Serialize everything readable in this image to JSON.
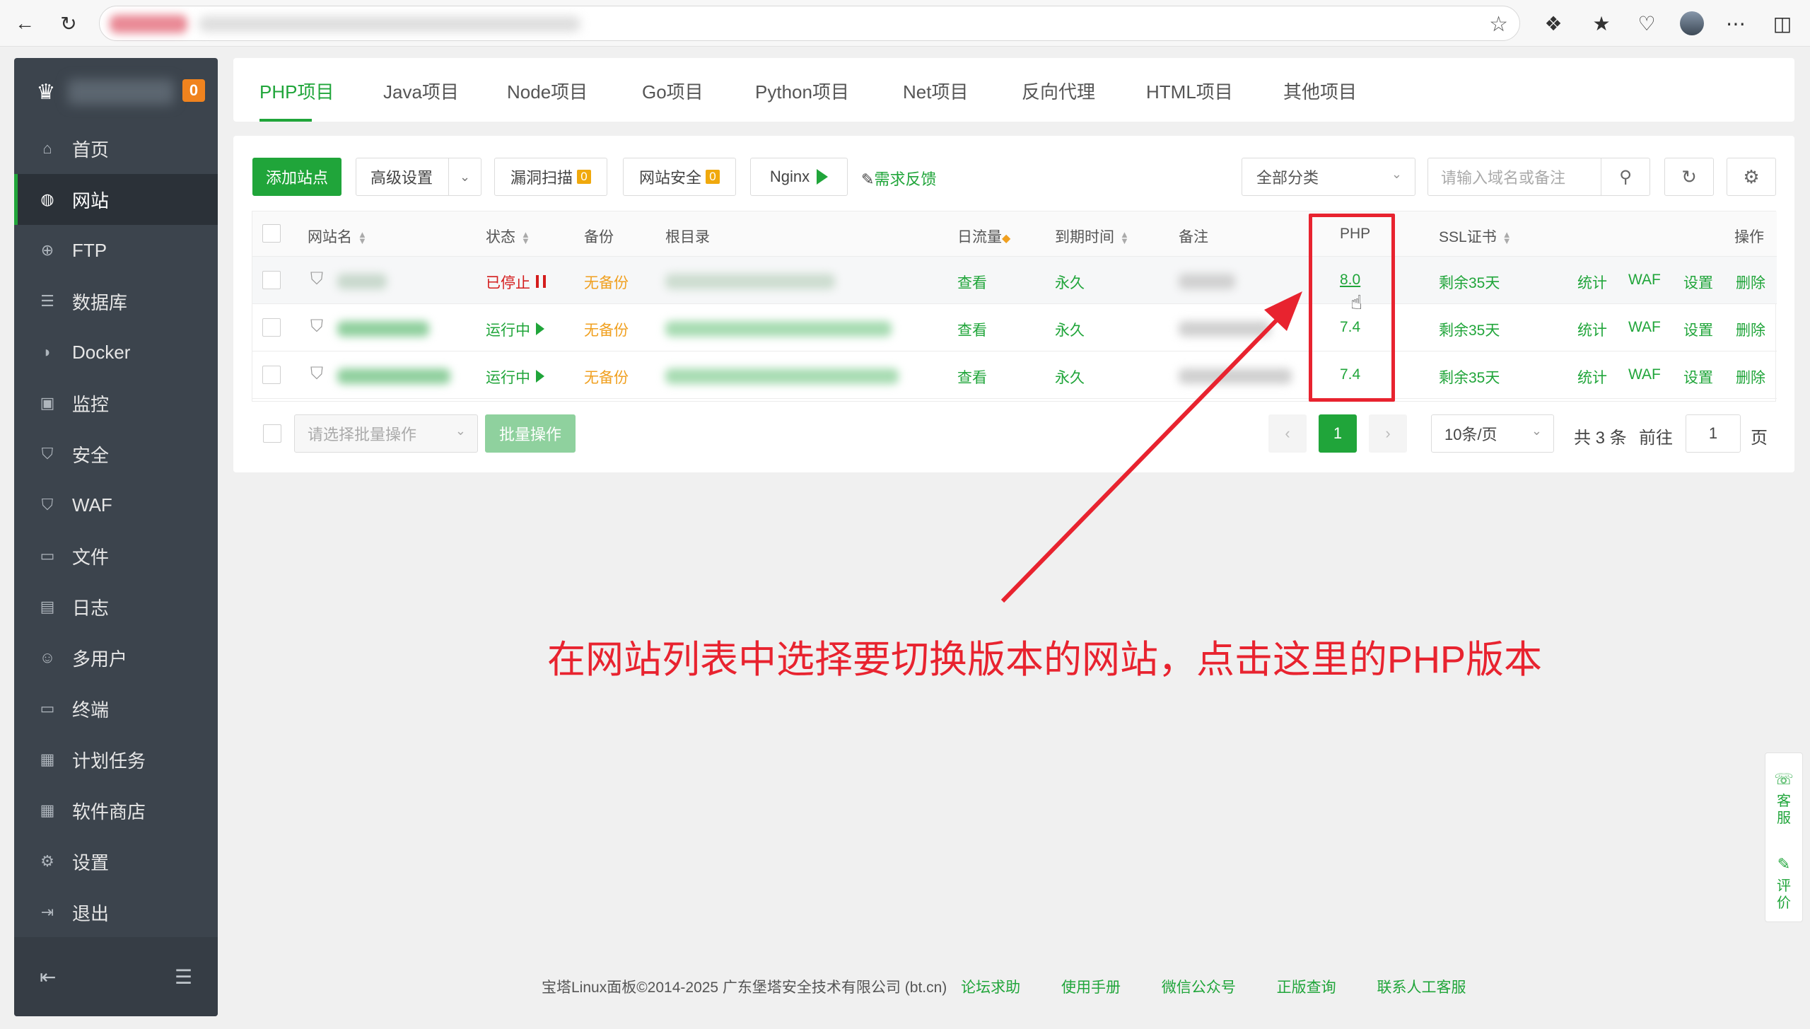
{
  "tabs": [
    "PHP项目",
    "Java项目",
    "Node项目",
    "Go项目",
    "Python项目",
    "Net项目",
    "反向代理",
    "HTML项目",
    "其他项目"
  ],
  "sidebar": {
    "badge": "0",
    "items": [
      {
        "label": "首页",
        "icon": "home-icon"
      },
      {
        "label": "网站",
        "icon": "globe-icon"
      },
      {
        "label": "FTP",
        "icon": "ftp-icon"
      },
      {
        "label": "数据库",
        "icon": "database-icon"
      },
      {
        "label": "Docker",
        "icon": "docker-icon"
      },
      {
        "label": "监控",
        "icon": "monitor-icon"
      },
      {
        "label": "安全",
        "icon": "shield-icon"
      },
      {
        "label": "WAF",
        "icon": "waf-icon"
      },
      {
        "label": "文件",
        "icon": "folder-icon"
      },
      {
        "label": "日志",
        "icon": "log-icon"
      },
      {
        "label": "多用户",
        "icon": "users-icon"
      },
      {
        "label": "终端",
        "icon": "terminal-icon"
      },
      {
        "label": "计划任务",
        "icon": "calendar-icon"
      },
      {
        "label": "软件商店",
        "icon": "apps-icon"
      },
      {
        "label": "设置",
        "icon": "gear-icon"
      },
      {
        "label": "退出",
        "icon": "logout-icon"
      }
    ]
  },
  "toolbar": {
    "add_site": "添加站点",
    "advanced": "高级设置",
    "vuln_scan": "漏洞扫描",
    "vuln_count": "0",
    "site_security": "网站安全",
    "security_count": "0",
    "nginx": "Nginx",
    "feedback": "需求反馈",
    "category": "全部分类",
    "search_placeholder": "请输入域名或备注"
  },
  "table": {
    "headers": {
      "name": "网站名",
      "status": "状态",
      "backup": "备份",
      "root": "根目录",
      "traffic": "日流量",
      "expire": "到期时间",
      "remark": "备注",
      "php": "PHP",
      "ssl": "SSL证书",
      "ops": "操作"
    },
    "rows": [
      {
        "status": "已停止",
        "backup": "无备份",
        "traffic": "查看",
        "expire": "永久",
        "php": "8.0",
        "ssl": "剩余35天"
      },
      {
        "status": "运行中",
        "backup": "无备份",
        "traffic": "查看",
        "expire": "永久",
        "php": "7.4",
        "ssl": "剩余35天"
      },
      {
        "status": "运行中",
        "backup": "无备份",
        "traffic": "查看",
        "expire": "永久",
        "php": "7.4",
        "ssl": "剩余35天"
      }
    ],
    "actions": [
      "统计",
      "WAF",
      "设置",
      "删除"
    ]
  },
  "batch": {
    "select_placeholder": "请选择批量操作",
    "button": "批量操作"
  },
  "pagination": {
    "current_page": "1",
    "per_page": "10条/页",
    "total": "共 3 条",
    "goto_label": "前往",
    "goto_value": "1",
    "page_suffix": "页"
  },
  "footer": {
    "copyright": "宝塔Linux面板©2014-2025 广东堡塔安全技术有限公司 (bt.cn)",
    "links": [
      "论坛求助",
      "使用手册",
      "微信公众号",
      "正版查询",
      "联系人工客服"
    ]
  },
  "float": {
    "service": "客服",
    "review": "评价"
  },
  "annotation": "在网站列表中选择要切换版本的网站，点击这里的PHP版本",
  "colors": {
    "accent": "#20a53a",
    "stopped": "#d41d1d",
    "backup": "#f0a020",
    "annotation": "#e8232f",
    "sidebar": "#3c444d"
  }
}
